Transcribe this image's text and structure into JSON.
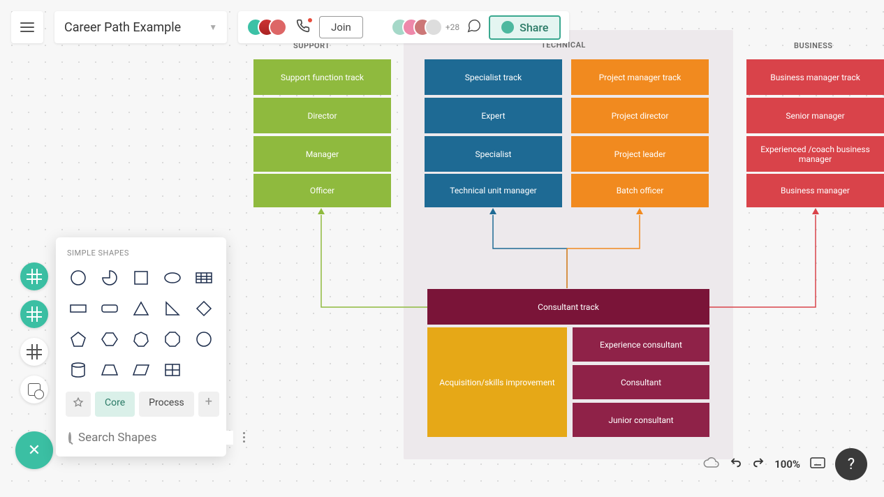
{
  "topbar": {
    "title": "Career Path Example",
    "join_label": "Join",
    "share_label": "Share",
    "plus_count": "+28"
  },
  "shapes_panel": {
    "heading": "SIMPLE SHAPES",
    "tabs": {
      "pin": "📌",
      "core": "Core",
      "process": "Process"
    },
    "search_placeholder": "Search Shapes"
  },
  "diagram": {
    "columns": {
      "support": {
        "label": "SUPPORT",
        "color": "#8fba3e",
        "items": [
          "Support   function   track",
          "Director",
          "Manager",
          "Officer"
        ]
      },
      "technical_left": {
        "color": "#1e6a94",
        "items": [
          "Specialist    track",
          "Expert",
          "Specialist",
          "Technical    unit   manager"
        ]
      },
      "technical_right": {
        "color": "#f18a1f",
        "items": [
          "Project   manager    track",
          "Project    director",
          "Project    leader",
          "Batch    officer"
        ]
      },
      "technical_label": "TECHNICAL",
      "business": {
        "label": "BUSINESS",
        "color": "#d9434a",
        "items": [
          "Business   manager    track",
          "Senior   manager",
          "Experienced    /coach   business manager",
          "Business   manager"
        ]
      },
      "consultant": {
        "header": "Consultant    track",
        "header_color": "#7a1438",
        "left": {
          "label": "Acquisition/skills improvement",
          "color": "#e6a817"
        },
        "right": {
          "color": "#8f2248",
          "items": [
            "Experience    consultant",
            "Consultant",
            "Junior    consultant"
          ]
        }
      }
    }
  },
  "bottom": {
    "zoom": "100%"
  }
}
